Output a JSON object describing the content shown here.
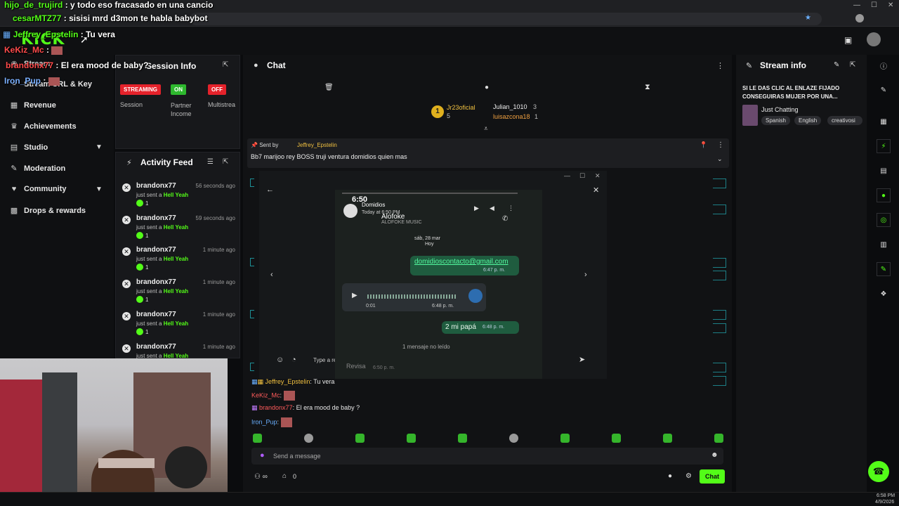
{
  "overlay_chat": [
    {
      "user": "hijo_de_trujird",
      "sep": ":",
      "text": "y todo eso fracasado en una cancio"
    },
    {
      "user": "cesarMTZ77",
      "sep": ":",
      "text": "sisisi mrd d3mon te habla babybot"
    },
    {
      "user": "Jeffrey_Epstelin",
      "sep": ":",
      "text": "Tu vera"
    },
    {
      "user": "KeKiz_Mc",
      "sep": ":",
      "text": ""
    },
    {
      "user": "brandonx77",
      "sep": ":",
      "text": "El era mood de baby?"
    },
    {
      "user": "Iron_Pup",
      "sep": ":",
      "text": ""
    }
  ],
  "brand": {
    "logo": "KICK",
    "accent": "#53fc18"
  },
  "sidebar": {
    "items": [
      {
        "icon": "stream-icon",
        "label": "Stream"
      },
      {
        "icon": "link-icon",
        "label": "Stream URL & Key"
      },
      {
        "icon": "revenue-icon",
        "label": "Revenue"
      },
      {
        "icon": "trophy-icon",
        "label": "Achievements"
      },
      {
        "icon": "studio-icon",
        "label": "Studio"
      },
      {
        "icon": "wrench-icon",
        "label": "Moderation"
      },
      {
        "icon": "community-icon",
        "label": "Community"
      },
      {
        "icon": "gift-icon",
        "label": "Drops & rewards"
      }
    ]
  },
  "session": {
    "title": "Session Info",
    "cards": [
      {
        "badge": "STREAMING",
        "label": "Session",
        "color": "#e5222b"
      },
      {
        "badge": "ON",
        "label": "Partner Income",
        "color": "#2eb82e"
      },
      {
        "badge": "OFF",
        "label": "Multistrea",
        "color": "#e5222b"
      }
    ]
  },
  "activity": {
    "title": "Activity Feed",
    "rows": [
      {
        "name": "brandonx77",
        "time": "56 seconds ago",
        "action": "just sent a",
        "item": "Hell Yeah",
        "count": "1"
      },
      {
        "name": "brandonx77",
        "time": "59 seconds ago",
        "action": "just sent a",
        "item": "Hell Yeah",
        "count": "1"
      },
      {
        "name": "brandonx77",
        "time": "1 minute ago",
        "action": "just sent a",
        "item": "Hell Yeah",
        "count": "1"
      },
      {
        "name": "brandonx77",
        "time": "1 minute ago",
        "action": "just sent a",
        "item": "Hell Yeah",
        "count": "1"
      },
      {
        "name": "brandonx77",
        "time": "1 minute ago",
        "action": "just sent a",
        "item": "Hell Yeah",
        "count": "1"
      },
      {
        "name": "brandonx77",
        "time": "1 minute ago",
        "action": "just sent a",
        "item": "Hell Yeah",
        "count": ""
      }
    ]
  },
  "chat": {
    "title": "Chat",
    "leaders": [
      {
        "name": "Jr23oficial",
        "count": "5"
      },
      {
        "name": "Julian_1010",
        "count": "3"
      },
      {
        "name": "luisazcona18",
        "count": "1"
      }
    ],
    "pinned": {
      "prefix": "Sent by",
      "user": "Jeffrey_Epstelin",
      "text": "Bb7 marijoo rey BOSS truji ventura domidios quien mas"
    },
    "messages": [
      {
        "user": "Jeffrey_Epstelin",
        "text": ": Tu vera"
      },
      {
        "user": "KeKiz_Mc",
        "text": ":"
      },
      {
        "user": "brandonx77",
        "text": ": El era mood de baby ?"
      },
      {
        "user": "Iron_Pup",
        "text": ":"
      }
    ],
    "input_placeholder": "Send a message",
    "footer_count": "0",
    "send_button": "Chat"
  },
  "phone": {
    "time": "6:50",
    "contact": "Domidios",
    "contact_sub": "Today at 6:50 PM",
    "name_overlay": "Alofoke",
    "channel": "ALOFOKE MUSIC",
    "date_line1": "sáb, 28 mar",
    "date_line2": "Hoy",
    "email": "domidioscontacto@gmail.com",
    "email_time": "6:47 p. m.",
    "audio_time": "0:01",
    "audio_stamp": "6:48 p. m.",
    "msg2": "2 mi papá",
    "msg2_time": "6:48 p. m.",
    "unread": "1 mensaje no leído",
    "reply_placeholder": "Type a reply...",
    "revisa": "Revisa",
    "revisa_time": "6:50 p. m."
  },
  "stream_info": {
    "title": "Stream info",
    "stream_title": "SI LE DAS CLIC AL ENLAZE FIJADO CONSEGUIRAS MUJER POR UNA...",
    "category": "Just Chatting",
    "tags": [
      "Spanish",
      "English",
      "creativosi"
    ]
  },
  "taskbar": {
    "time": "6:58 PM",
    "date": "4/9/2026"
  }
}
